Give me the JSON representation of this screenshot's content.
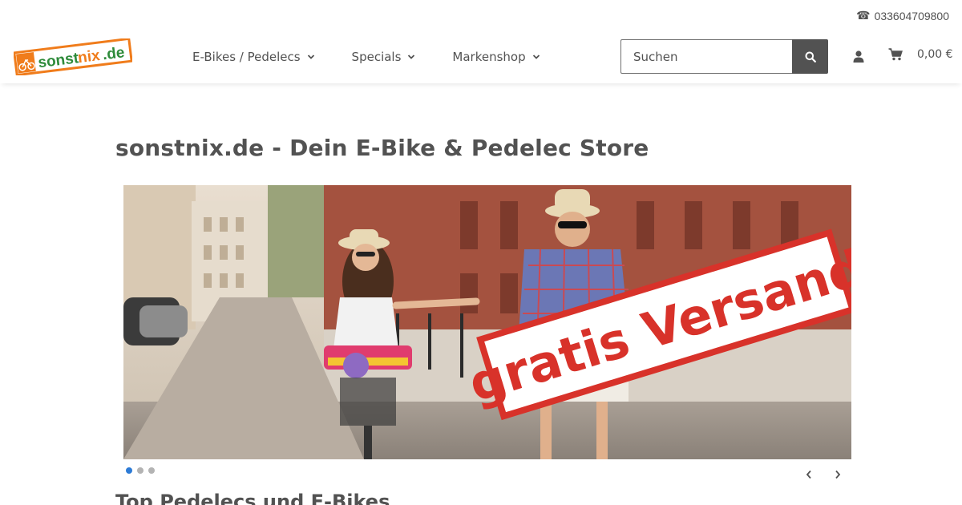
{
  "topbar": {
    "phone": "033604709800",
    "phone_icon": "phone-icon"
  },
  "header": {
    "logo_text": "sonstnix.de",
    "nav": [
      {
        "label": "E-Bikes / Pedelecs"
      },
      {
        "label": "Specials"
      },
      {
        "label": "Markenshop"
      }
    ],
    "search": {
      "placeholder": "Suchen",
      "icon": "search-icon"
    },
    "account_icon": "user-icon",
    "cart": {
      "icon": "cart-icon",
      "total": "0,00 €"
    }
  },
  "main": {
    "title": "sonstnix.de - Dein E-Bike & Pedelec Store",
    "slider": {
      "stamp_text": "gratis Versand",
      "slide_count": 3,
      "active_slide": 1
    },
    "section_heading": "Top Pedelecs und E-Bikes"
  },
  "colors": {
    "text": "#525252",
    "logo_orange": "#f07c1b",
    "logo_green": "#2e8b3a",
    "stamp_red": "#d8322a",
    "dot_active": "#2d7bd6",
    "dot_inactive": "#b3b3b3"
  }
}
